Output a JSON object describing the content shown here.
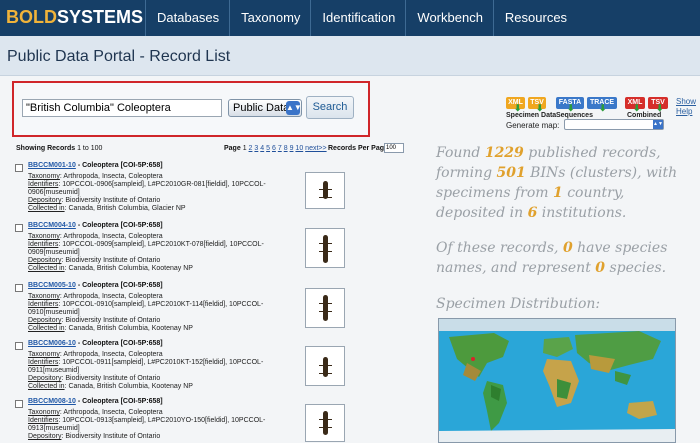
{
  "app": {
    "logo_bold": "BOLD",
    "logo_systems": "SYSTEMS",
    "nav": [
      "Databases",
      "Taxonomy",
      "Identification",
      "Workbench",
      "Resources"
    ]
  },
  "header": {
    "title": "Public Data Portal - Record List"
  },
  "search": {
    "query": "\"British Columbia\" Coleoptera",
    "scope": "Public Data",
    "button": "Search"
  },
  "downloads": {
    "specimen": {
      "label": "Specimen Data",
      "buttons": [
        "XML",
        "TSV"
      ]
    },
    "sequences": {
      "label": "Sequences",
      "buttons": [
        "FASTA",
        "TRACE"
      ]
    },
    "combined": {
      "label": "Combined",
      "buttons": [
        "XML",
        "TSV"
      ]
    },
    "show_help": "Show Help",
    "generate_map": "Generate map:"
  },
  "listing": {
    "showing_label": "Showing Records",
    "showing_range": "1 to 100",
    "page_label": "Page",
    "pages": [
      "1",
      "2",
      "3",
      "4",
      "5",
      "6",
      "7",
      "8",
      "9",
      "10"
    ],
    "next": "next>>",
    "per_page_label": "Records Per Page",
    "per_page": "100"
  },
  "records": [
    {
      "id": "BBCCM001-10",
      "title": "- Coleoptera [COI-5P:658]",
      "taxonomy": "Arthropoda, Insecta, Coleoptera",
      "identifiers1": "10PCCOL-0906[sampleid], L#PC2010GR-081[fieldid], 10PCCOL-",
      "identifiers2": "0906[museumid]",
      "depository": "Biodiversity Institute of Ontario",
      "collected": "Canada, British Columbia, Glacier NP"
    },
    {
      "id": "BBCCM004-10",
      "title": "- Coleoptera [COI-5P:658]",
      "taxonomy": "Arthropoda, Insecta, Coleoptera",
      "identifiers1": "10PCCOL-0909[sampleid], L#PC2010KT-078[fieldid], 10PCCOL-",
      "identifiers2": "0909[museumid]",
      "depository": "Biodiversity Institute of Ontario",
      "collected": "Canada, British Columbia, Kootenay NP"
    },
    {
      "id": "BBCCM005-10",
      "title": "- Coleoptera [COI-5P:658]",
      "taxonomy": "Arthropoda, Insecta, Coleoptera",
      "identifiers1": "10PCCOL-0910[sampleid], L#PC2010KT-114[fieldid], 10PCCOL-",
      "identifiers2": "0910[museumid]",
      "depository": "Biodiversity Institute of Ontario",
      "collected": "Canada, British Columbia, Kootenay NP"
    },
    {
      "id": "BBCCM006-10",
      "title": "- Coleoptera [COI-5P:658]",
      "taxonomy": "Arthropoda, Insecta, Coleoptera",
      "identifiers1": "10PCCOL-0911[sampleid], L#PC2010KT-152[fieldid], 10PCCOL-",
      "identifiers2": "0911[museumid]",
      "depository": "Biodiversity Institute of Ontario",
      "collected": "Canada, British Columbia, Kootenay NP"
    },
    {
      "id": "BBCCM008-10",
      "title": "- Coleoptera [COI-5P:658]",
      "taxonomy": "Arthropoda, Insecta, Coleoptera",
      "identifiers1": "10PCCOL-0913[sampleid], L#PC2010YO-150[fieldid], 10PCCOL-",
      "identifiers2": "0913[museumid]",
      "depository": "Biodiversity Institute of Ontario",
      "collected": ""
    }
  ],
  "labels": {
    "taxonomy": "Taxonomy",
    "identifiers": "Identifiers",
    "depository": "Depository",
    "collected": "Collected in"
  },
  "summary": {
    "s1": "Found ",
    "records": "1229",
    "s2": " published records, forming ",
    "bins": "501",
    "s3": " BINs (clusters), with specimens from ",
    "countries": "1",
    "s4": " country, deposited in ",
    "institutions": "6",
    "s5": " institutions.",
    "t1": "Of these records, ",
    "species_names": "0",
    "t2": " have species names, and represent ",
    "species": "0",
    "t3": " species.",
    "distribution_title": "Specimen Distribution:"
  },
  "colors": {
    "nav_bg": "#163f67",
    "accent": "#e0a12d",
    "link": "#1f57a6",
    "highlight_border": "#d0262a"
  }
}
